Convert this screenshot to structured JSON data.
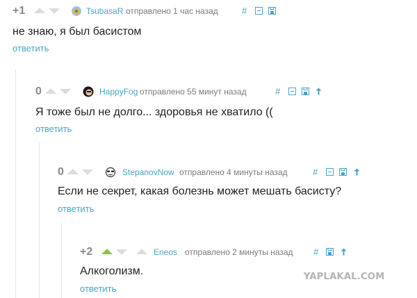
{
  "comments": [
    {
      "rating": "+1",
      "upvoted": false,
      "username": "TsubasaR",
      "avatar_icon": "avatar-icon",
      "meta": "отправлено  1 час назад",
      "hash_label": "#",
      "text": "не знаю, я был басистом",
      "reply_label": "ответить"
    },
    {
      "rating": "0",
      "upvoted": false,
      "username": "HappyFog",
      "avatar_icon": "avatar-icon",
      "meta": "отправлено  55 минут назад",
      "hash_label": "#",
      "text": "Я тоже был не долго... здоровья не хватило ((",
      "reply_label": "ответить"
    },
    {
      "rating": "0",
      "upvoted": false,
      "username": "StepanovNow",
      "avatar_icon": "avatar-icon",
      "meta": "отправлено  4 минуты назад",
      "hash_label": "#",
      "text": "Если не секрет, какая болезнь может мешать басисту?",
      "reply_label": "ответить"
    },
    {
      "rating": "+2",
      "upvoted": true,
      "username": "Eneos",
      "meta": "отправлено  2 минуты назад",
      "hash_label": "#",
      "text": "Алкоголизм.",
      "reply_label": "ответить"
    }
  ],
  "watermark": "YAPLAKAL.COM",
  "colors": {
    "link": "#4aa3c8",
    "text": "#222222",
    "meta": "#7a7a7a",
    "rating": "#8a8a8a",
    "vote_inactive": "#dcdcdc",
    "vote_active": "#8bc34a"
  }
}
